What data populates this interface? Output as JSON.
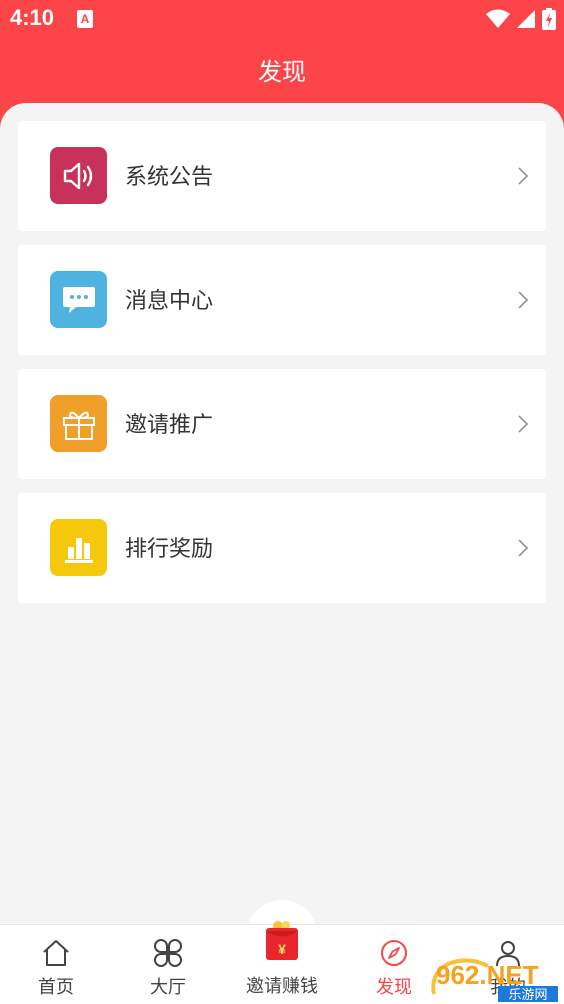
{
  "status_bar": {
    "time": "4:10",
    "app_icon_letter": "A"
  },
  "header": {
    "title": "发现",
    "color": "#fb4549"
  },
  "menu": [
    {
      "label": "系统公告",
      "icon": "speaker-icon",
      "color": "#c8325a"
    },
    {
      "label": "消息中心",
      "icon": "chat-bubble-icon",
      "color": "#4eb3e1"
    },
    {
      "label": "邀请推广",
      "icon": "gift-icon",
      "color": "#f0a02a"
    },
    {
      "label": "排行奖励",
      "icon": "bar-chart-icon",
      "color": "#f6c80c"
    }
  ],
  "tabbar": {
    "tabs": [
      {
        "label": "首页",
        "icon": "home-icon"
      },
      {
        "label": "大厅",
        "icon": "grid-clover-icon"
      },
      {
        "label": "邀请赚钱",
        "icon": "red-packet-icon"
      },
      {
        "label": "发现",
        "icon": "compass-icon",
        "active": true
      },
      {
        "label": "我的",
        "icon": "user-icon"
      }
    ],
    "active_color": "#fb4549"
  },
  "watermark": {
    "brand": "962.NET",
    "sub": "乐游网"
  }
}
